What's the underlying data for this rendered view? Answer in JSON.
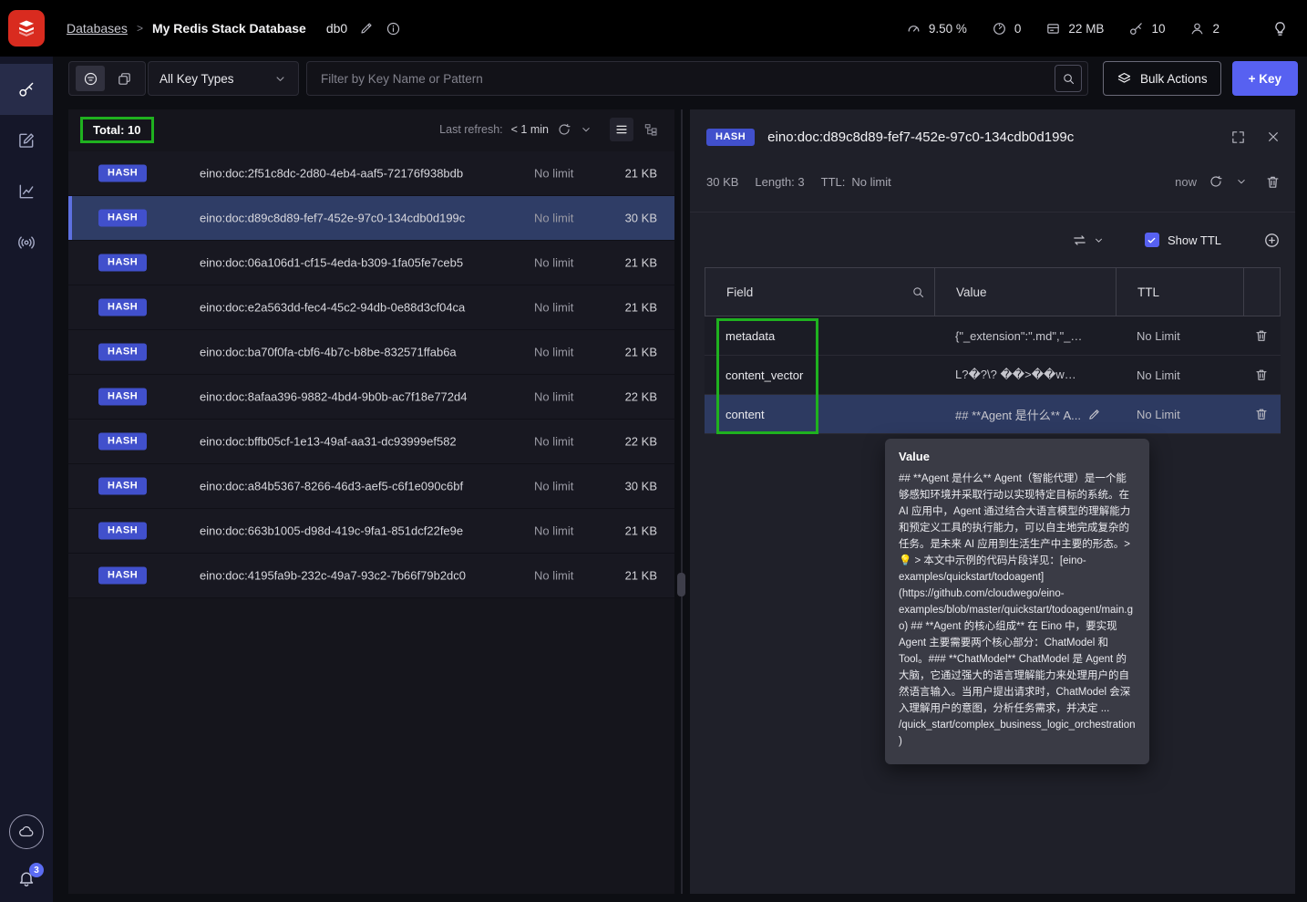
{
  "header": {
    "breadcrumb": {
      "root": "Databases",
      "separator": ">",
      "current": "My Redis Stack Database"
    },
    "db_label": "db0",
    "stats": [
      {
        "name": "cpu-usage",
        "value": "9.50 %"
      },
      {
        "name": "commands-per-sec",
        "value": "0"
      },
      {
        "name": "memory-usage",
        "value": "22 MB"
      },
      {
        "name": "total-keys",
        "value": "10"
      },
      {
        "name": "connected-clients",
        "value": "2"
      }
    ]
  },
  "sidebar": {
    "notification_count": "3"
  },
  "filter_bar": {
    "key_type_select": "All Key Types",
    "search_placeholder": "Filter by Key Name or Pattern",
    "bulk_actions_label": "Bulk Actions",
    "add_key_label": "+ Key"
  },
  "key_list": {
    "total_label": "Total: 10",
    "last_refresh_label": "Last refresh:",
    "last_refresh_value": "< 1 min",
    "rows": [
      {
        "type": "HASH",
        "name": "eino:doc:2f51c8dc-2d80-4eb4-aaf5-72176f938bdb",
        "ttl": "No limit",
        "size": "21 KB",
        "selected": false
      },
      {
        "type": "HASH",
        "name": "eino:doc:d89c8d89-fef7-452e-97c0-134cdb0d199c",
        "ttl": "No limit",
        "size": "30 KB",
        "selected": true
      },
      {
        "type": "HASH",
        "name": "eino:doc:06a106d1-cf15-4eda-b309-1fa05fe7ceb5",
        "ttl": "No limit",
        "size": "21 KB",
        "selected": false
      },
      {
        "type": "HASH",
        "name": "eino:doc:e2a563dd-fec4-45c2-94db-0e88d3cf04ca",
        "ttl": "No limit",
        "size": "21 KB",
        "selected": false
      },
      {
        "type": "HASH",
        "name": "eino:doc:ba70f0fa-cbf6-4b7c-b8be-832571ffab6a",
        "ttl": "No limit",
        "size": "21 KB",
        "selected": false
      },
      {
        "type": "HASH",
        "name": "eino:doc:8afaa396-9882-4bd4-9b0b-ac7f18e772d4",
        "ttl": "No limit",
        "size": "22 KB",
        "selected": false
      },
      {
        "type": "HASH",
        "name": "eino:doc:bffb05cf-1e13-49af-aa31-dc93999ef582",
        "ttl": "No limit",
        "size": "22 KB",
        "selected": false
      },
      {
        "type": "HASH",
        "name": "eino:doc:a84b5367-8266-46d3-aef5-c6f1e090c6bf",
        "ttl": "No limit",
        "size": "30 KB",
        "selected": false
      },
      {
        "type": "HASH",
        "name": "eino:doc:663b1005-d98d-419c-9fa1-851dcf22fe9e",
        "ttl": "No limit",
        "size": "21 KB",
        "selected": false
      },
      {
        "type": "HASH",
        "name": "eino:doc:4195fa9b-232c-49a7-93c2-7b66f79b2dc0",
        "ttl": "No limit",
        "size": "21 KB",
        "selected": false
      }
    ]
  },
  "details": {
    "type_badge": "HASH",
    "key_name": "eino:doc:d89c8d89-fef7-452e-97c0-134cdb0d199c",
    "size": "30 KB",
    "length_label": "Length: 3",
    "ttl_label": "TTL:",
    "ttl_value": "No limit",
    "refresh_value": "now",
    "show_ttl_label": "Show TTL",
    "columns": {
      "field": "Field",
      "value": "Value",
      "ttl": "TTL"
    },
    "rows": [
      {
        "field": "metadata",
        "value": "{\"_extension\":\".md\",\"_fi...",
        "ttl": "No Limit",
        "editable": false,
        "selected": false
      },
      {
        "field": "content_vector",
        "value": "L?�?\\? ��>��w�...",
        "ttl": "No Limit",
        "editable": false,
        "selected": false
      },
      {
        "field": "content",
        "value": "## **Agent 是什么** A...",
        "ttl": "No Limit",
        "editable": true,
        "selected": true
      }
    ],
    "tooltip": {
      "title": "Value",
      "body": "## **Agent 是什么** Agent（智能代理）是一个能够感知环境并采取行动以实现特定目标的系统。在 AI 应用中，Agent 通过结合大语言模型的理解能力和预定义工具的执行能力，可以自主地完成复杂的任务。是未来 AI 应用到生活生产中主要的形态。> 💡 > 本文中示例的代码片段详见：[eino-examples/quickstart/todoagent](https://github.com/cloudwego/eino-examples/blob/master/quickstart/todoagent/main.go) ## **Agent 的核心组成** 在 Eino 中，要实现 Agent 主要需要两个核心部分：ChatModel 和 Tool。### **ChatModel** ChatModel 是 Agent 的大脑，它通过强大的语言理解能力来处理用户的自然语言输入。当用户提出请求时，ChatModel 会深入理解用户的意图，分析任务需求，并决定 ... /quick_start/complex_business_logic_orchestration)"
    }
  }
}
